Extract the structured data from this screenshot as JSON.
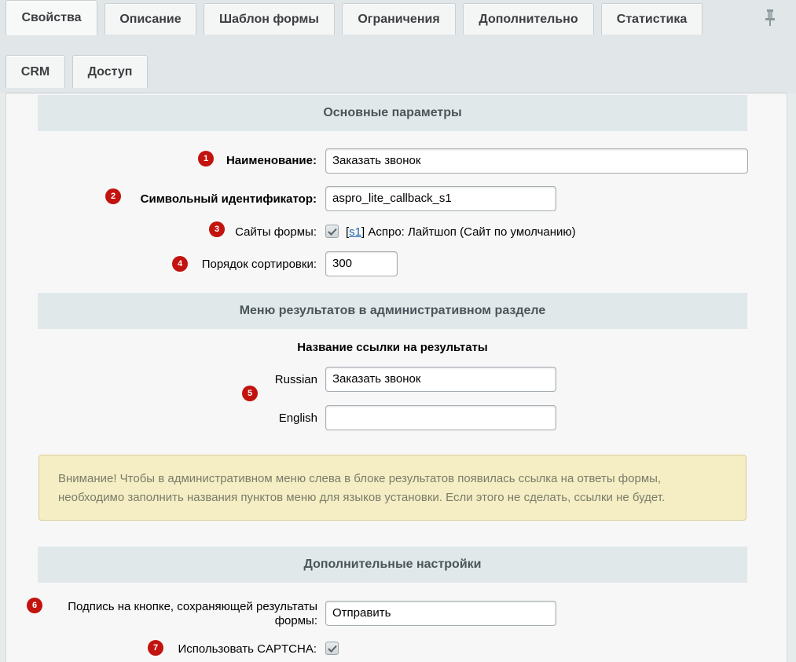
{
  "tabs": {
    "row1": [
      "Свойства",
      "Описание",
      "Шаблон формы",
      "Ограничения",
      "Дополнительно",
      "Статистика"
    ],
    "row2": [
      "CRM",
      "Доступ"
    ],
    "active": "Свойства"
  },
  "sections": {
    "basic": "Основные параметры",
    "menu": "Меню результатов в административном разделе",
    "extra": "Дополнительные настройки"
  },
  "fields": {
    "name": {
      "badge": "1",
      "label": "Наименование:",
      "value": "Заказать звонок"
    },
    "sid": {
      "badge": "2",
      "label": "Символьный идентификатор:",
      "value": "aspro_lite_callback_s1"
    },
    "sites": {
      "badge": "3",
      "label": "Сайты формы:",
      "checked": true,
      "site_code": "s1",
      "site_text_open": "[",
      "site_text_close": "] Аспро: Лайтшоп (Сайт по умолчанию)"
    },
    "sort": {
      "badge": "4",
      "label": "Порядок сортировки:",
      "value": "300"
    }
  },
  "menu_results": {
    "subheading": "Название ссылки на результаты",
    "badge": "5",
    "russian": {
      "label": "Russian",
      "value": "Заказать звонок"
    },
    "english": {
      "label": "English",
      "value": ""
    }
  },
  "notice": {
    "line1": "Внимание! Чтобы в административном меню слева в блоке результатов появилась ссылка на ответы формы,",
    "line2": "необходимо заполнить названия пунктов меню для языков установки. Если этого не сделать, ссылки не будет."
  },
  "extra": {
    "button_caption": {
      "badge": "6",
      "label_line1": "Подпись на кнопке, сохраняющей результаты",
      "label_line2": "формы:",
      "value": "Отправить"
    },
    "captcha": {
      "badge": "7",
      "label": "Использовать CAPTCHA:",
      "checked": true
    }
  },
  "colors": {
    "badge": "#c2130e",
    "section_header": "#e0e8ea",
    "notice_bg": "#f5eec4",
    "link": "#2067b0"
  }
}
